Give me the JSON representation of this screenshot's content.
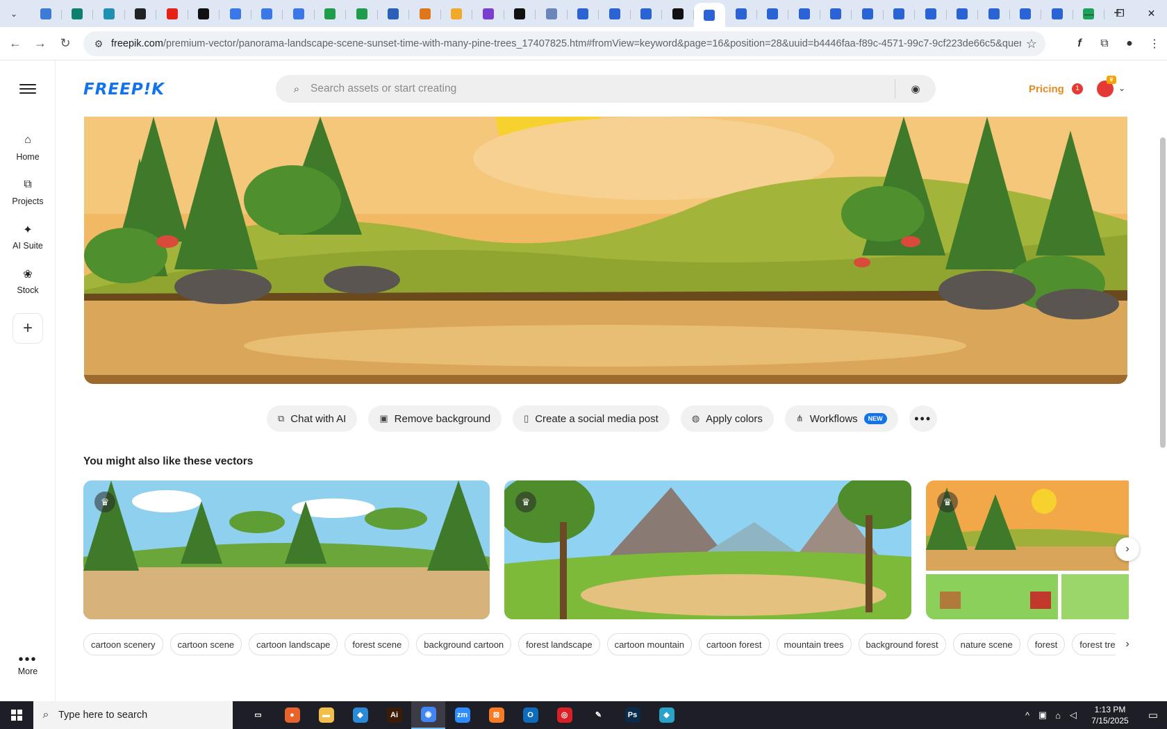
{
  "browser": {
    "url_host": "freepik.com",
    "url_rest": "/premium-vector/panorama-landscape-scene-sunset-time-with-many-pine-trees_17407825.htm#fromView=keyword&page=16&position=28&uuid=b4446faa-f89c-4571-99c7-9cf223de66c5&query...",
    "tabs": [
      {
        "icon": "edge-icon",
        "color": "#3d7bd6"
      },
      {
        "icon": "shield-icon",
        "color": "#0c7f6e"
      },
      {
        "icon": "arrow-icon",
        "color": "#1f8fb3"
      },
      {
        "icon": "openai-icon",
        "color": "#222222"
      },
      {
        "icon": "youtube-icon",
        "color": "#e62117"
      },
      {
        "icon": "bolt-icon",
        "color": "#111111"
      },
      {
        "icon": "docs-icon",
        "color": "#3b78e7"
      },
      {
        "icon": "docs-icon",
        "color": "#3b78e7"
      },
      {
        "icon": "docs-icon",
        "color": "#3b78e7"
      },
      {
        "icon": "sheets-icon",
        "color": "#1e9e4a"
      },
      {
        "icon": "sheets-icon",
        "color": "#1e9e4a"
      },
      {
        "icon": "word-icon",
        "color": "#2b5fb8"
      },
      {
        "icon": "grid-icon",
        "color": "#e0761c"
      },
      {
        "icon": "wing-icon",
        "color": "#f0a92a"
      },
      {
        "icon": "code-icon",
        "color": "#7b3fd0"
      },
      {
        "icon": "a-icon",
        "color": "#111111"
      },
      {
        "icon": "table-icon",
        "color": "#6b86b8"
      },
      {
        "icon": "form-icon",
        "color": "#2a63d4"
      },
      {
        "icon": "form-icon",
        "color": "#2a63d4"
      },
      {
        "icon": "form-icon",
        "color": "#2a63d4"
      },
      {
        "icon": "m-icon",
        "color": "#111111"
      },
      {
        "icon": "form-icon",
        "color": "#2a63d4",
        "active": true
      },
      {
        "icon": "form-icon",
        "color": "#2a63d4"
      },
      {
        "icon": "form-icon",
        "color": "#2a63d4"
      },
      {
        "icon": "form-icon",
        "color": "#2a63d4"
      },
      {
        "icon": "form-icon",
        "color": "#2a63d4"
      },
      {
        "icon": "form-icon",
        "color": "#2a63d4"
      },
      {
        "icon": "form-icon",
        "color": "#2a63d4"
      },
      {
        "icon": "form-icon",
        "color": "#2a63d4"
      },
      {
        "icon": "form-icon",
        "color": "#2a63d4"
      },
      {
        "icon": "form-icon",
        "color": "#2a63d4"
      },
      {
        "icon": "form-icon",
        "color": "#2a63d4"
      },
      {
        "icon": "form-icon",
        "color": "#2a63d4"
      },
      {
        "icon": "w-icon",
        "color": "#1ba35a"
      }
    ]
  },
  "sidebar": {
    "items": [
      {
        "label": "Home",
        "icon": "home-icon"
      },
      {
        "label": "Projects",
        "icon": "projects-icon"
      },
      {
        "label": "AI Suite",
        "icon": "sparkle-icon"
      },
      {
        "label": "Stock",
        "icon": "stock-icon"
      }
    ],
    "more": "More"
  },
  "header": {
    "logo": "FREEP!K",
    "search_placeholder": "Search assets or start creating",
    "pricing": "Pricing",
    "notification_count": "1"
  },
  "actions": [
    {
      "label": "Chat with AI",
      "icon": "chat-icon"
    },
    {
      "label": "Remove background",
      "icon": "remove-bg-icon"
    },
    {
      "label": "Create a social media post",
      "icon": "phone-icon"
    },
    {
      "label": "Apply colors",
      "icon": "palette-icon"
    },
    {
      "label": "Workflows",
      "icon": "workflow-icon",
      "badge": "NEW"
    }
  ],
  "related": {
    "title": "You might also like these vectors"
  },
  "tags": [
    "cartoon scenery",
    "cartoon scene",
    "cartoon landscape",
    "forest scene",
    "background cartoon",
    "forest landscape",
    "cartoon mountain",
    "cartoon forest",
    "mountain trees",
    "background forest",
    "nature scene",
    "forest",
    "forest tre"
  ],
  "taskbar": {
    "search_placeholder": "Type here to search",
    "time": "1:13 PM",
    "date": "7/15/2025",
    "apps": [
      {
        "name": "task-view-icon",
        "color": "#1e1f26",
        "glyph": "▭"
      },
      {
        "name": "firefox-icon",
        "color": "#e8632b",
        "glyph": "●"
      },
      {
        "name": "file-explorer-icon",
        "color": "#f2c04a",
        "glyph": "▬"
      },
      {
        "name": "vscode-icon",
        "color": "#2a8ad8",
        "glyph": "◆"
      },
      {
        "name": "illustrator-icon",
        "color": "#3c1c06",
        "glyph": "Ai"
      },
      {
        "name": "chrome-icon",
        "color": "#4285f4",
        "glyph": "◉",
        "active": true
      },
      {
        "name": "zoom-icon",
        "color": "#2d8cff",
        "glyph": "zm"
      },
      {
        "name": "xampp-icon",
        "color": "#fb7a24",
        "glyph": "⊠"
      },
      {
        "name": "outlook-icon",
        "color": "#0f6cbd",
        "glyph": "O"
      },
      {
        "name": "creative-cloud-icon",
        "color": "#da1f26",
        "glyph": "◎"
      },
      {
        "name": "pen-tool-icon",
        "color": "#1e1f26",
        "glyph": "✎"
      },
      {
        "name": "photoshop-icon",
        "color": "#0b2b4a",
        "glyph": "Ps"
      },
      {
        "name": "app-icon",
        "color": "#2aa3c9",
        "glyph": "◆"
      }
    ]
  }
}
